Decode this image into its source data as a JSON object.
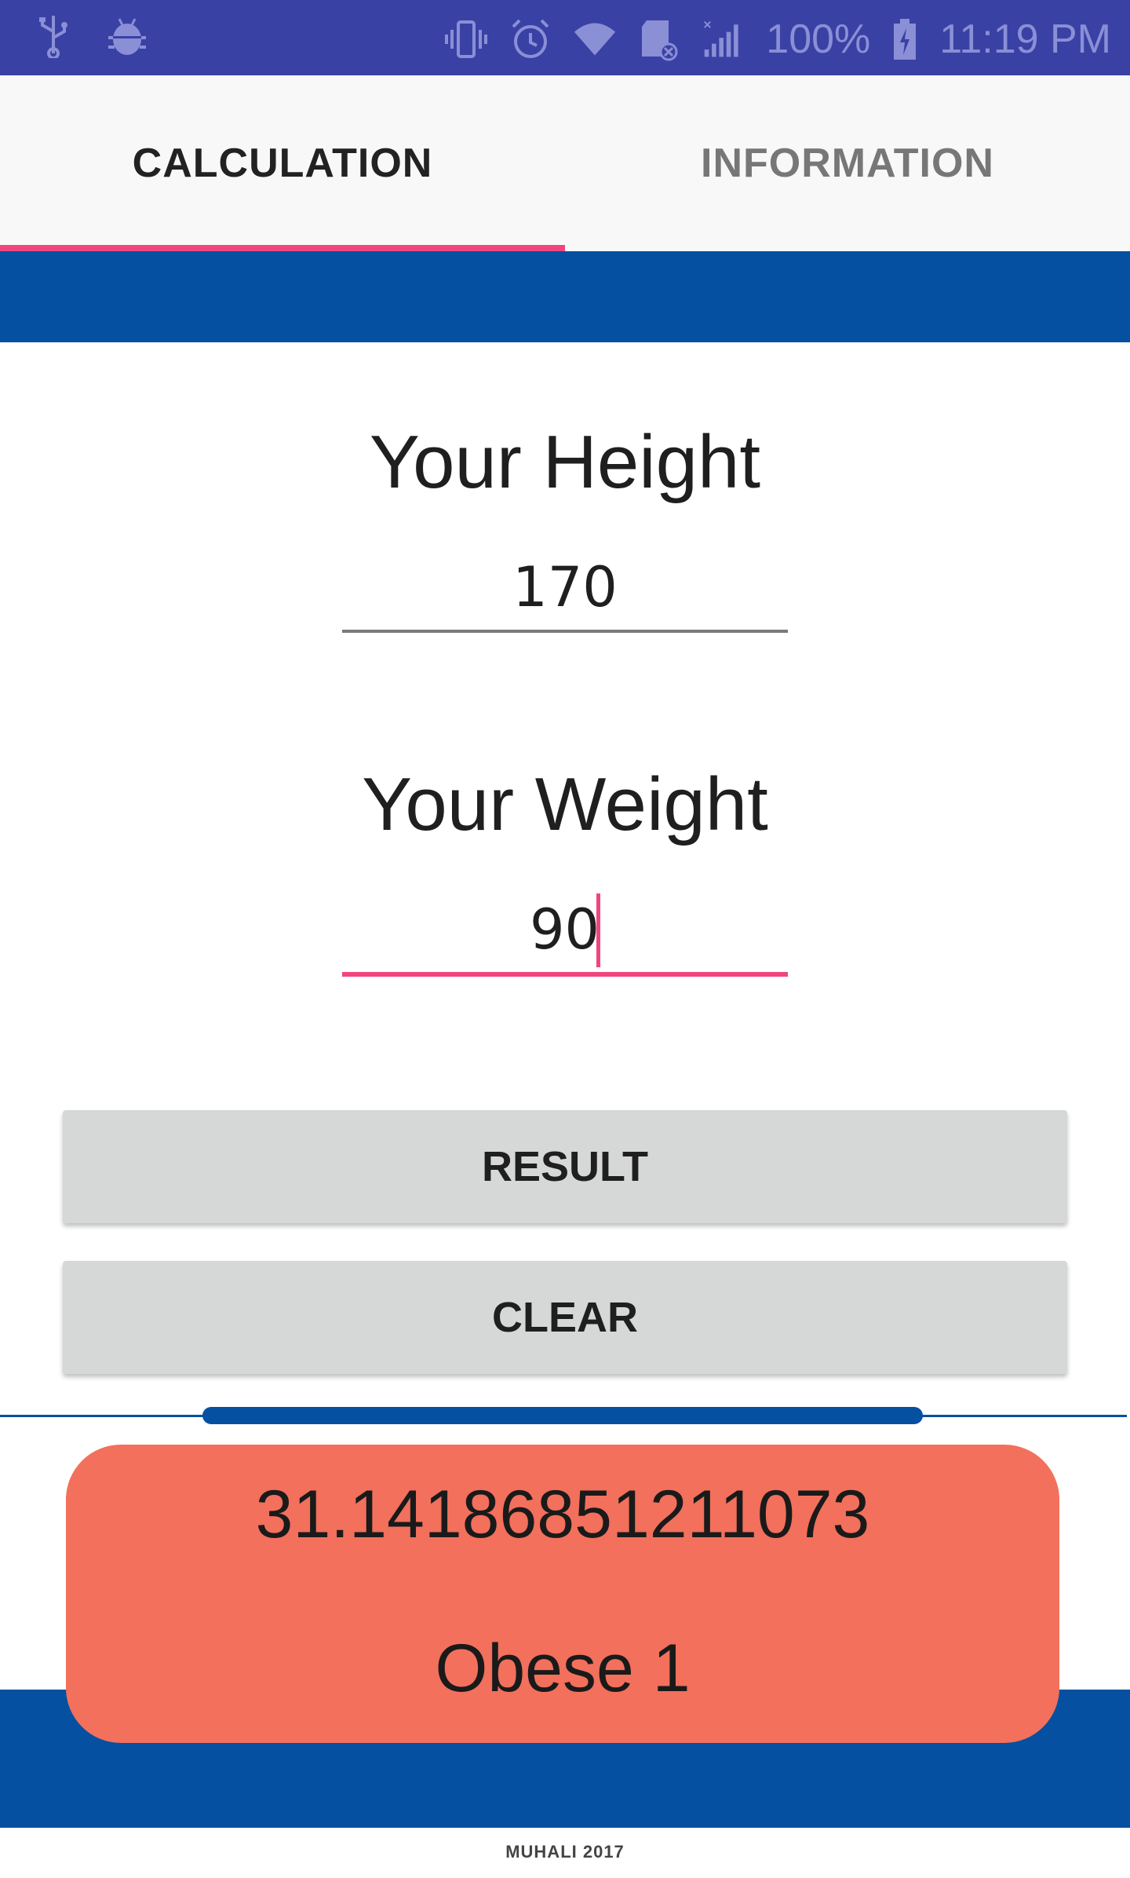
{
  "status_bar": {
    "battery": "100%",
    "time": "11:19 PM",
    "icons": [
      "usb-icon",
      "android-debug-icon",
      "vibrate-icon",
      "alarm-icon",
      "wifi-icon",
      "sd-card-icon",
      "signal-icon",
      "battery-icon"
    ],
    "background_color": "#3a41a4"
  },
  "tabs": [
    {
      "label": "CALCULATION",
      "selected": true
    },
    {
      "label": "INFORMATION",
      "selected": false
    }
  ],
  "form": {
    "height_label": "Your Height",
    "height_value": "170",
    "weight_label": "Your Weight",
    "weight_value": "90"
  },
  "buttons": {
    "result_label": "RESULT",
    "clear_label": "CLEAR"
  },
  "result": {
    "bmi_value": "31.14186851211073",
    "category": "Obese 1",
    "card_color": "#f2705c"
  },
  "footer": {
    "text": "MUHALI 2017"
  },
  "colors": {
    "accent": "#f0457e",
    "primary_blue": "#0550a0"
  }
}
